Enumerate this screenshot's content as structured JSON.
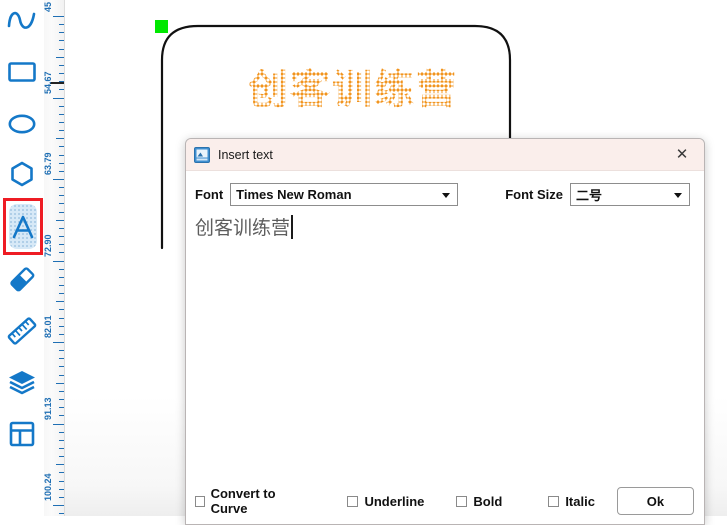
{
  "toolbar": {
    "tools": [
      {
        "name": "curve-tool",
        "icon": "wave-icon",
        "selected": false
      },
      {
        "name": "rectangle-tool",
        "icon": "rectangle-icon",
        "selected": false
      },
      {
        "name": "ellipse-tool",
        "icon": "ellipse-icon",
        "selected": false
      },
      {
        "name": "polygon-tool",
        "icon": "hexagon-icon",
        "selected": false
      },
      {
        "name": "text-tool",
        "icon": "letter-a-icon",
        "selected": true
      },
      {
        "name": "eraser-tool",
        "icon": "eraser-icon",
        "selected": false
      },
      {
        "name": "ruler-tool",
        "icon": "ruler-icon",
        "selected": false
      },
      {
        "name": "layers-tool",
        "icon": "layers-icon",
        "selected": false
      },
      {
        "name": "layout-tool",
        "icon": "layout-icon",
        "selected": false
      }
    ],
    "selection_color": "#ee1c24",
    "icon_color": "#1478c8"
  },
  "ruler": {
    "orientation": "vertical",
    "labels": [
      "45",
      "54.67",
      "63.79",
      "72.90",
      "82.01",
      "91.13",
      "100.24"
    ],
    "tick_color": "#1f6fb4"
  },
  "canvas": {
    "shape": {
      "name": "rounded-rectangle",
      "stroke": "#111111"
    },
    "handle_color": "#00e800",
    "art_text": "创客训练营",
    "art_text_color": "#f2941e"
  },
  "dialog": {
    "title": "Insert text",
    "icon": "insert-text-window-icon",
    "close_label": "✕",
    "font_label": "Font",
    "font_value": "Times New Roman",
    "font_size_label": "Font Size",
    "font_size_value": "二号",
    "text_value": "创客训练营",
    "checkboxes": [
      {
        "label": "Convert to Curve",
        "checked": false
      },
      {
        "label": "Underline",
        "checked": false
      },
      {
        "label": "Bold",
        "checked": false
      },
      {
        "label": "Italic",
        "checked": false
      }
    ],
    "ok_label": "Ok",
    "titlebar_color": "#faeeeb"
  }
}
